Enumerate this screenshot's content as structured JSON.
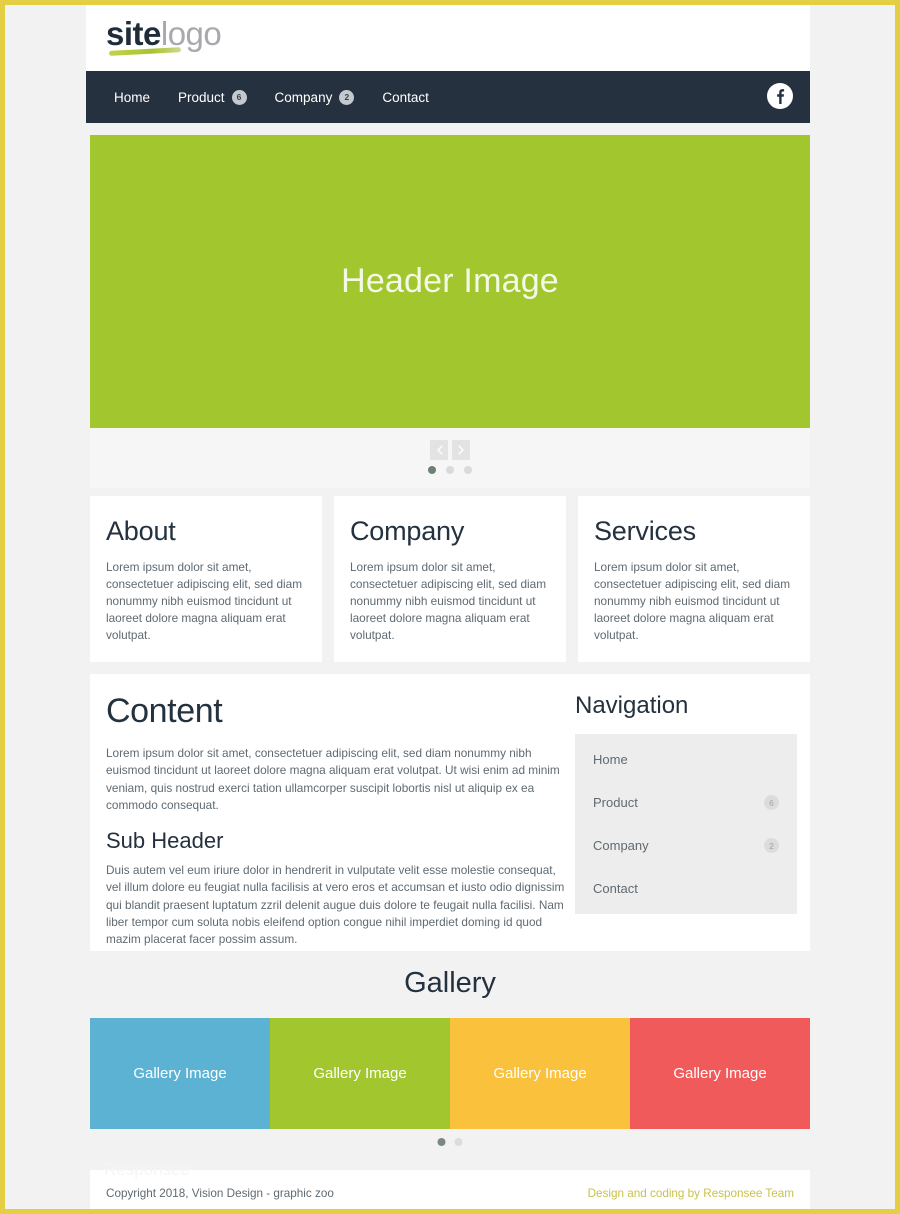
{
  "theme": {
    "page_border": "#E4CE43",
    "page_bg": "#F2F2F2",
    "nav_bg": "#25313F",
    "accent_green": "#A2C62E",
    "text_dark": "#24313E",
    "text_body": "#5F6A72"
  },
  "logo": {
    "bold_part": "site",
    "light_part": "logo"
  },
  "topnav": {
    "items": [
      {
        "label": "Home",
        "badge": null
      },
      {
        "label": "Product",
        "badge": "6"
      },
      {
        "label": "Company",
        "badge": "2"
      },
      {
        "label": "Contact",
        "badge": null
      }
    ],
    "social_icon": "facebook-icon"
  },
  "hero": {
    "text": "Header Image",
    "bg_color": "#A2C62E",
    "prev_icon": "chevron-left-icon",
    "next_icon": "chevron-right-icon",
    "dots": [
      {
        "active": true
      },
      {
        "active": false
      },
      {
        "active": false
      }
    ]
  },
  "cards": [
    {
      "title": "About",
      "body": "Lorem ipsum dolor sit amet, consectetuer adipiscing elit, sed diam nonummy nibh euismod tincidunt ut laoreet dolore magna aliquam erat volutpat."
    },
    {
      "title": "Company",
      "body": "Lorem ipsum dolor sit amet, consectetuer adipiscing elit, sed diam nonummy nibh euismod tincidunt ut laoreet dolore magna aliquam erat volutpat."
    },
    {
      "title": "Services",
      "body": "Lorem ipsum dolor sit amet, consectetuer adipiscing elit, sed diam nonummy nibh euismod tincidunt ut laoreet dolore magna aliquam erat volutpat."
    }
  ],
  "content": {
    "title": "Content",
    "intro": "Lorem ipsum dolor sit amet, consectetuer adipiscing elit, sed diam nonummy nibh euismod tincidunt ut laoreet dolore magna aliquam erat volutpat. Ut wisi enim ad minim veniam, quis nostrud exerci tation ullamcorper suscipit lobortis nisl ut aliquip ex ea commodo consequat.",
    "subtitle": "Sub Header",
    "body": "Duis autem vel eum iriure dolor in hendrerit in vulputate velit esse molestie consequat, vel illum dolore eu feugiat nulla facilisis at vero eros et accumsan et iusto odio dignissim qui blandit praesent luptatum zzril delenit augue duis dolore te feugait nulla facilisi. Nam liber tempor cum soluta nobis eleifend option congue nihil imperdiet doming id quod mazim placerat facer possim assum."
  },
  "sidebar_nav": {
    "title": "Navigation",
    "items": [
      {
        "label": "Home",
        "badge": null
      },
      {
        "label": "Product",
        "badge": "6"
      },
      {
        "label": "Company",
        "badge": "2"
      },
      {
        "label": "Contact",
        "badge": null
      }
    ]
  },
  "gallery": {
    "title": "Gallery",
    "tiles": [
      {
        "label": "Gallery Image",
        "color": "#5BB2D3"
      },
      {
        "label": "Gallery Image",
        "color": "#A2C62E"
      },
      {
        "label": "Gallery Image",
        "color": "#F9C13C"
      },
      {
        "label": "Gallery Image",
        "color": "#F05A5A"
      }
    ],
    "dots": [
      {
        "active": true
      },
      {
        "active": false
      }
    ]
  },
  "footer": {
    "ghost_text": "Responsee",
    "copyright": "Copyright 2018, Vision Design - graphic zoo",
    "credit": "Design and coding by Responsee Team"
  }
}
